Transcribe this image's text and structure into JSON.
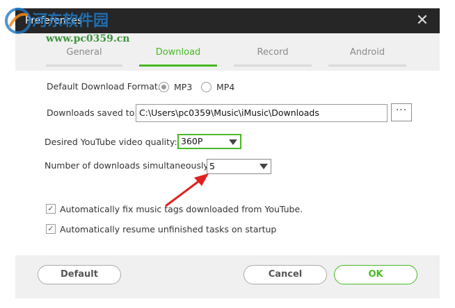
{
  "window": {
    "title": "Preferences",
    "close_glyph": "✕"
  },
  "tabs": [
    {
      "label": "General",
      "active": false
    },
    {
      "label": "Download",
      "active": true
    },
    {
      "label": "Record",
      "active": false
    },
    {
      "label": "Android",
      "active": false
    }
  ],
  "download": {
    "format_label": "Default Download Format:",
    "format_options": [
      {
        "label": "MP3",
        "selected": true
      },
      {
        "label": "MP4",
        "selected": false
      }
    ],
    "saved_to_label": "Downloads saved to:",
    "saved_to_value": "C:\\Users\\pc0359\\Music\\iMusic\\Downloads",
    "browse_label": "···",
    "quality_label": "Desired YouTube video quality:",
    "quality_value": "360P",
    "simultaneous_label": "Number of downloads simultaneously:",
    "simultaneous_value": "5",
    "fix_tags_label": "Automatically fix music tags downloaded from YouTube.",
    "fix_tags_checked": true,
    "resume_label": "Automatically resume unfinished tasks on startup",
    "resume_checked": true
  },
  "footer": {
    "default_label": "Default",
    "cancel_label": "Cancel",
    "ok_label": "OK"
  },
  "watermark": {
    "site_name": "河东软件园",
    "url": "www.pc0359.cn"
  },
  "colors": {
    "accent": "#47b823",
    "title_bg": "#262626",
    "annotation_arrow": "#e02020"
  }
}
